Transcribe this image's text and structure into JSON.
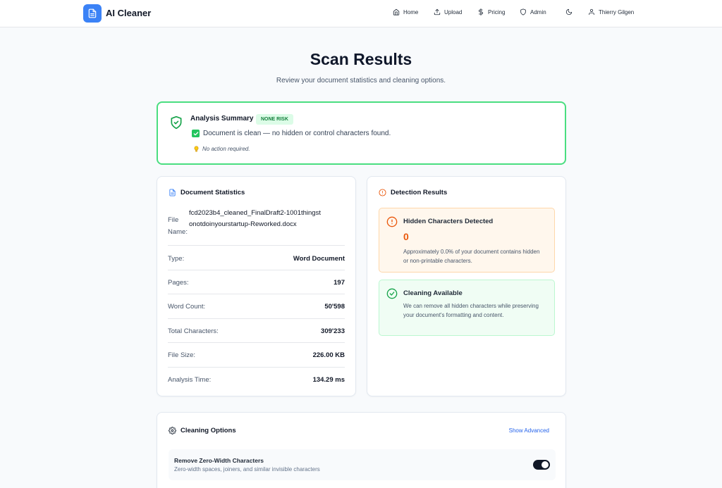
{
  "app": {
    "title": "AI Cleaner"
  },
  "nav": {
    "home": "Home",
    "upload": "Upload",
    "pricing": "Pricing",
    "admin": "Admin",
    "user": "Thierry Gilgen"
  },
  "page": {
    "title": "Scan Results",
    "subtitle": "Review your document statistics and cleaning options."
  },
  "summary": {
    "title": "Analysis Summary",
    "risk_badge": "NONE RISK",
    "clean_message": "Document is clean — no hidden or control characters found.",
    "tip": "No action required."
  },
  "statistics": {
    "title": "Document Statistics",
    "file_name_label": "File Name:",
    "file_name": "fcd2023b4_cleaned_FinalDraft2-1001thingstonotdoinyourstartup-Reworked.docx",
    "rows": [
      {
        "label": "Type:",
        "value": "Word Document"
      },
      {
        "label": "Pages:",
        "value": "197"
      },
      {
        "label": "Word Count:",
        "value": "50'598"
      },
      {
        "label": "Total Characters:",
        "value": "309'233"
      },
      {
        "label": "File Size:",
        "value": "226.00 KB"
      },
      {
        "label": "Analysis Time:",
        "value": "134.29 ms"
      }
    ]
  },
  "detection": {
    "title": "Detection Results",
    "hidden": {
      "title": "Hidden Characters Detected",
      "count": "0",
      "text": "Approximately 0.0% of your document contains hidden or non-printable characters."
    },
    "cleaning": {
      "title": "Cleaning Available",
      "text": "We can remove all hidden characters while preserving your document's formatting and content."
    }
  },
  "options": {
    "title": "Cleaning Options",
    "show_advanced": "Show Advanced",
    "items": [
      {
        "title": "Remove Zero-Width Characters",
        "description": "Zero-width spaces, joiners, and similar invisible characters",
        "enabled": true
      }
    ]
  },
  "colors": {
    "accent": "#3b82f6",
    "success": "#22c55e",
    "warning": "#ea580c",
    "link": "#2563eb"
  }
}
